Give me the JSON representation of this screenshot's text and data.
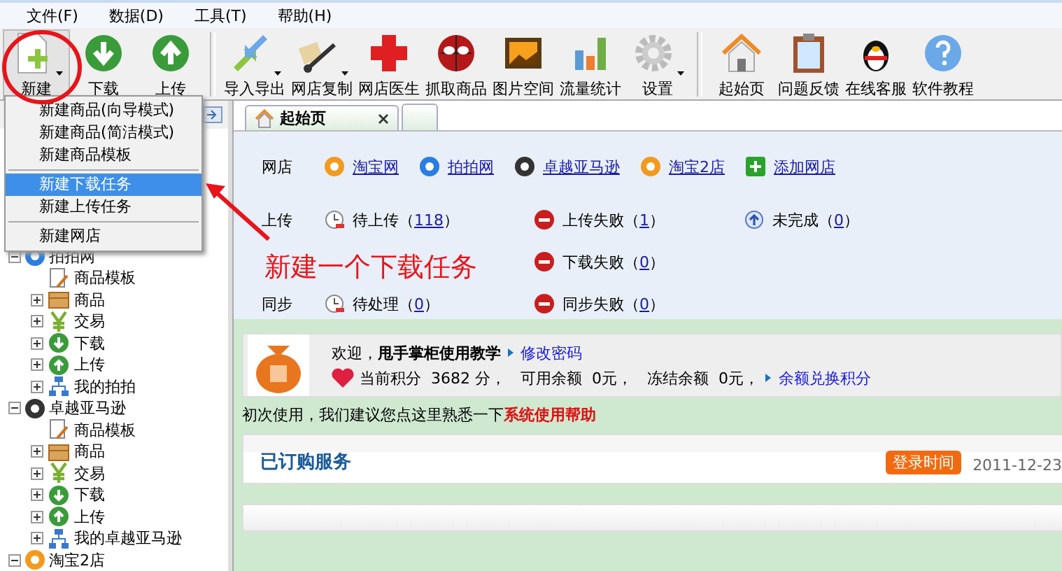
{
  "menu_bar": [
    {
      "label": "文件(F)"
    },
    {
      "label": "数据(D)"
    },
    {
      "label": "工具(T)"
    },
    {
      "label": "帮助(H)"
    }
  ],
  "toolbar": [
    {
      "label": "新建",
      "caret": true,
      "selected": true
    },
    {
      "label": "下载",
      "caret": false,
      "selected": false
    },
    {
      "label": "上传",
      "caret": false,
      "selected": false
    },
    {
      "kind": "separator"
    },
    {
      "label": "导入导出",
      "caret": true,
      "selected": false
    },
    {
      "label": "网店复制",
      "caret": true,
      "selected": false
    },
    {
      "label": "网店医生",
      "caret": false,
      "selected": false
    },
    {
      "label": "抓取商品",
      "caret": false,
      "selected": false
    },
    {
      "label": "图片空间",
      "caret": false,
      "selected": false
    },
    {
      "label": "流量统计",
      "caret": false,
      "selected": false
    },
    {
      "label": "设置",
      "caret": true,
      "selected": false
    },
    {
      "kind": "separator"
    },
    {
      "label": "起始页",
      "caret": false,
      "selected": false
    },
    {
      "label": "问题反馈",
      "caret": false,
      "selected": false
    },
    {
      "label": "在线客服",
      "caret": false,
      "selected": false
    },
    {
      "label": "软件教程",
      "caret": false,
      "selected": false
    }
  ],
  "dropdown_menu": [
    {
      "kind": "item",
      "label": "新建商品(向导模式)",
      "selected": false
    },
    {
      "kind": "item",
      "label": "新建商品(简洁模式)",
      "selected": false
    },
    {
      "kind": "item",
      "label": "新建商品模板",
      "selected": false
    },
    {
      "kind": "separator"
    },
    {
      "kind": "item",
      "label": "新建下载任务",
      "selected": true
    },
    {
      "kind": "item",
      "label": "新建上传任务",
      "selected": false
    },
    {
      "kind": "separator"
    },
    {
      "kind": "item",
      "label": "新建网店",
      "selected": false
    }
  ],
  "tree": [
    {
      "label": "拍拍网",
      "color": "#2a7de1",
      "expanded": true,
      "children": [
        {
          "label": "商品模板",
          "kind": "template"
        },
        {
          "label": "商品",
          "kind": "goods",
          "expanded": false
        },
        {
          "label": "交易",
          "kind": "trade",
          "expanded": false
        },
        {
          "label": "下载",
          "kind": "download",
          "expanded": false
        },
        {
          "label": "上传",
          "kind": "upload",
          "expanded": false
        },
        {
          "label": "我的拍拍",
          "kind": "network",
          "expanded": false
        }
      ]
    },
    {
      "label": "卓越亚马逊",
      "color": "#333333",
      "expanded": true,
      "children": [
        {
          "label": "商品模板",
          "kind": "template"
        },
        {
          "label": "商品",
          "kind": "goods",
          "expanded": false
        },
        {
          "label": "交易",
          "kind": "trade",
          "expanded": false
        },
        {
          "label": "下载",
          "kind": "download",
          "expanded": false
        },
        {
          "label": "上传",
          "kind": "upload",
          "expanded": false
        },
        {
          "label": "我的卓越亚马逊",
          "kind": "network",
          "expanded": false
        }
      ]
    },
    {
      "label": "淘宝2店",
      "color": "#f39a1e",
      "expanded": true
    }
  ],
  "tabs": [
    {
      "label": "起始页",
      "selected": true
    },
    {
      "selected": false
    }
  ],
  "shops": {
    "label": "网店",
    "links": [
      {
        "kind": "shop",
        "label": "淘宝网",
        "color": "#f39a1e"
      },
      {
        "kind": "shop",
        "label": "拍拍网",
        "color": "#2a7de1"
      },
      {
        "kind": "shop",
        "label": "卓越亚马逊",
        "color": "#333333"
      },
      {
        "kind": "shop",
        "label": "淘宝2店",
        "color": "#f39a1e"
      },
      {
        "kind": "add",
        "label": "添加网店"
      }
    ]
  },
  "status_rows": [
    {
      "label": "上传",
      "items": [
        {
          "kind": "pending",
          "label": "待上传（",
          "count": "118",
          "suffix": "）"
        },
        {
          "kind": "failed",
          "label": "上传失败（",
          "count": "1",
          "suffix": "）"
        },
        {
          "kind": "incomplete",
          "label": "未完成（",
          "count": "0",
          "suffix": "）"
        }
      ]
    },
    {
      "items": [
        {
          "kind": "hidden"
        },
        {
          "kind": "failed",
          "label": "下载失败（",
          "count": "0",
          "suffix": "）"
        }
      ]
    },
    {
      "label": "同步",
      "items": [
        {
          "kind": "pending",
          "label": "待处理（",
          "count": "0",
          "suffix": "）"
        },
        {
          "kind": "failed",
          "label": "同步失败（",
          "count": "0",
          "suffix": "）"
        }
      ]
    }
  ],
  "welcome": {
    "greeting": "欢迎，**甩手掌柜使用教学**",
    "change_password": "修改密码",
    "balance": "当前积分  3682 分，   可用余额  0元，   冻结余额  0元，",
    "exchange_link": "余额兑换积分"
  },
  "help_line": {
    "text": "初次使用，我们建议您点这里熟悉一下",
    "link": "系统使用帮助"
  },
  "services": {
    "title": "已订购服务",
    "badge": "登录时间",
    "date": "2011-12-23"
  },
  "annotation": {
    "text": "新建一个下载任务"
  }
}
